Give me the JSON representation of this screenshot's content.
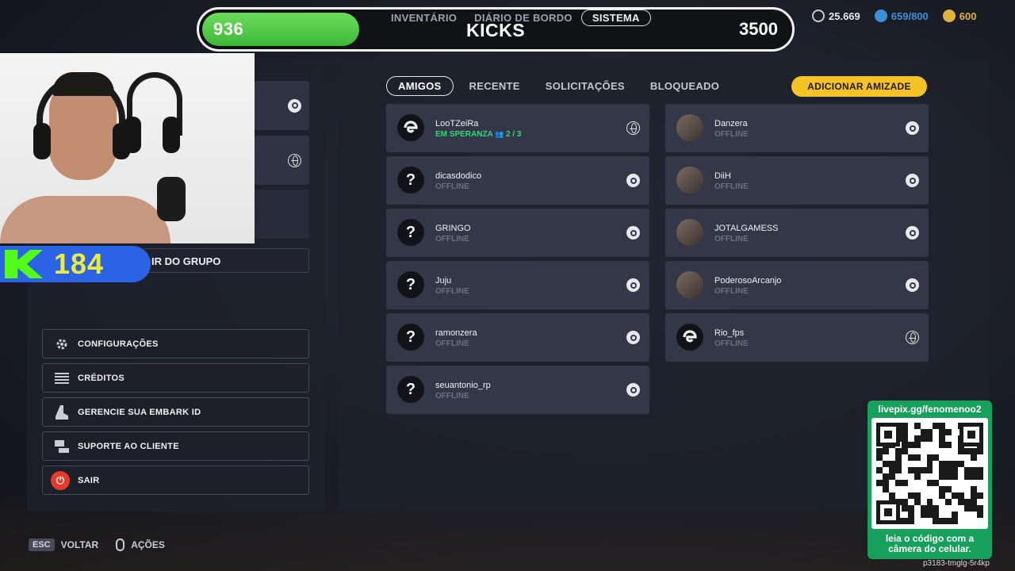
{
  "top_bar": {
    "kicks_current": "936",
    "kicks_label": "KICKS",
    "kicks_goal": "3500",
    "progress_fraction": 0.267,
    "tabs": [
      {
        "label": "INVENTÁRIO"
      },
      {
        "label": "DIÁRIO DE BORDO"
      },
      {
        "label": "SISTEMA"
      }
    ]
  },
  "currencies": [
    {
      "icon": "coin-icon",
      "value": "25.669",
      "color": "#c9c9c9"
    },
    {
      "icon": "vault-icon",
      "value": "659/800",
      "color": "#3d8fd6"
    },
    {
      "icon": "multibucks-icon",
      "value": "600",
      "color": "#e0b43a"
    }
  ],
  "stream": {
    "kick_follower_count": "184"
  },
  "left_panel": {
    "group_button": "IR DO GRUPO",
    "menu": [
      {
        "label": "CONFIGURAÇÕES",
        "icon": "gear-icon"
      },
      {
        "label": "CRÉDITOS",
        "icon": "list-icon"
      },
      {
        "label": "GERENCIE SUA EMBARK ID",
        "icon": "boot-icon"
      },
      {
        "label": "SUPORTE AO CLIENTE",
        "icon": "chat-icon"
      },
      {
        "label": "SAIR",
        "icon": "power-icon"
      }
    ]
  },
  "friends": {
    "tabs": [
      {
        "label": "AMIGOS"
      },
      {
        "label": "RECENTE"
      },
      {
        "label": "SOLICITAÇÕES"
      },
      {
        "label": "BLOQUEADO"
      }
    ],
    "add_button": "ADICIONAR AMIZADE",
    "left_column": [
      {
        "name": "LooTZeiRa",
        "status": "EM SPERANZA",
        "party": "2 / 3",
        "avatar": "embark-logo-icon",
        "platform": "globe-icon"
      },
      {
        "name": "dicasdodico",
        "status": "OFFLINE",
        "avatar": "unknown-avatar-icon",
        "platform": "steam-icon"
      },
      {
        "name": "GRINGO",
        "status": "OFFLINE",
        "avatar": "unknown-avatar-icon",
        "platform": "steam-icon"
      },
      {
        "name": "Juju",
        "status": "OFFLINE",
        "avatar": "unknown-avatar-icon",
        "platform": "steam-icon"
      },
      {
        "name": "ramonzera",
        "status": "OFFLINE",
        "avatar": "unknown-avatar-icon",
        "platform": "steam-icon"
      },
      {
        "name": "seuantonio_rp",
        "status": "OFFLINE",
        "avatar": "unknown-avatar-icon",
        "platform": "steam-icon"
      }
    ],
    "right_column": [
      {
        "name": "Danzera",
        "status": "OFFLINE",
        "avatar": "photo-avatar",
        "platform": "steam-icon"
      },
      {
        "name": "DiiH",
        "status": "OFFLINE",
        "avatar": "photo-avatar",
        "platform": "steam-icon"
      },
      {
        "name": "JOTALGAMESS",
        "status": "OFFLINE",
        "avatar": "photo-avatar",
        "platform": "steam-icon"
      },
      {
        "name": "PoderosoArcanjo",
        "status": "OFFLINE",
        "avatar": "photo-avatar",
        "platform": "steam-icon"
      },
      {
        "name": "Rio_fps",
        "status": "OFFLINE",
        "avatar": "embark-logo-icon",
        "platform": "globe-icon"
      }
    ]
  },
  "hints": [
    {
      "key": "ESC",
      "label": "VOLTAR"
    },
    {
      "key": "mouse-icon",
      "label": "AÇÕES"
    }
  ],
  "livepix": {
    "url": "livepix.gg/fenomenoo2",
    "caption_line1": "leia o código com a",
    "caption_line2": "câmera do celular.",
    "code": "p3183-tmglg-5r4kp"
  }
}
